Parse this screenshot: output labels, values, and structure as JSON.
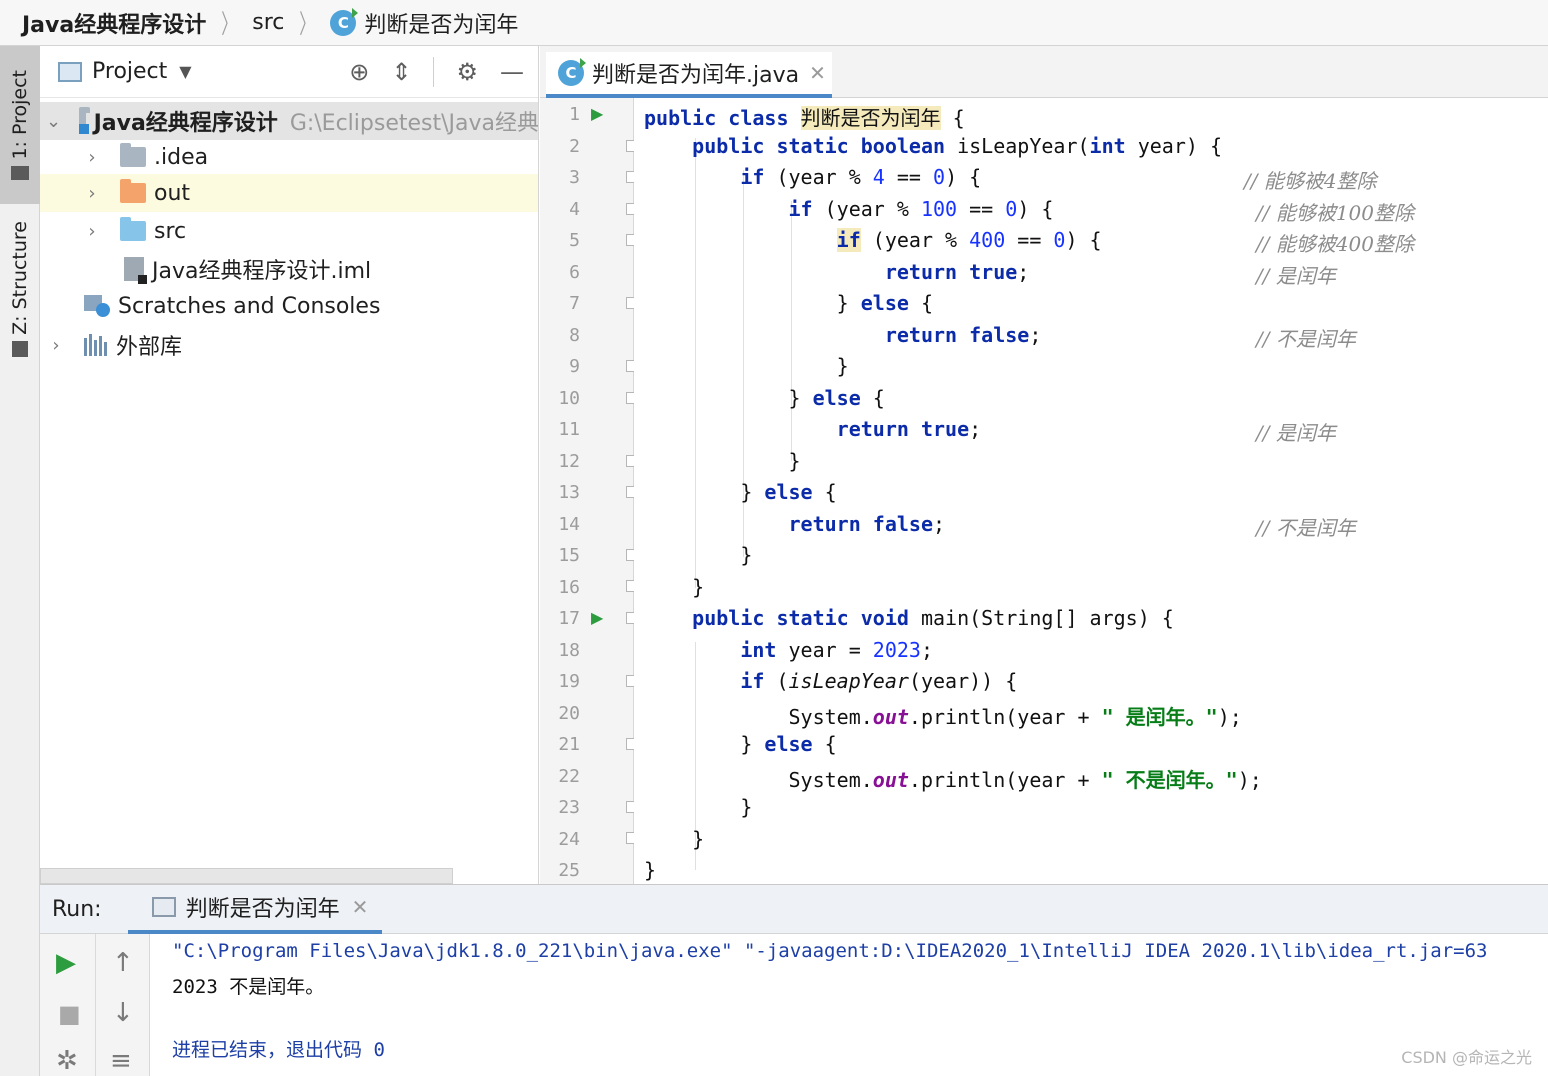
{
  "breadcrumb": {
    "project": "Java经典程序设计",
    "folder": "src",
    "file": "判断是否为闰年"
  },
  "left_strip": {
    "project_tab": "1: Project",
    "structure_tab": "Z: Structure"
  },
  "project_panel": {
    "title": "Project",
    "root_name": "Java经典程序设计",
    "root_path": "G:\\Eclipsetest\\Java经典",
    "items": [
      {
        "label": ".idea",
        "icon": "folder-gray"
      },
      {
        "label": "out",
        "icon": "folder-orange"
      },
      {
        "label": "src",
        "icon": "folder-blue"
      },
      {
        "label": "Java经典程序设计.iml",
        "icon": "iml-file"
      }
    ],
    "scratches": "Scratches and Consoles",
    "external_libs": "外部库"
  },
  "editor": {
    "tab_label": "判断是否为闰年.java",
    "line_numbers": [
      "1",
      "2",
      "3",
      "4",
      "5",
      "6",
      "7",
      "8",
      "9",
      "10",
      "11",
      "12",
      "13",
      "14",
      "15",
      "16",
      "17",
      "18",
      "19",
      "20",
      "21",
      "22",
      "23",
      "24",
      "25"
    ],
    "code": {
      "l1_kw": "public class",
      "l1_name": "判断是否为闰年",
      "l1_tail": " {",
      "l2_kw": "public static boolean",
      "l2_rest": " isLeapYear(",
      "l2_kw2": "int",
      "l2_tail": " year) {",
      "l3_kw": "if",
      "l3_a": " (year % ",
      "l3_n1": "4",
      "l3_b": " == ",
      "l3_n2": "0",
      "l3_c": ") {",
      "l3_cmt": "// 能够被4整除",
      "l4_kw": "if",
      "l4_a": " (year % ",
      "l4_n1": "100",
      "l4_b": " == ",
      "l4_n2": "0",
      "l4_c": ") {",
      "l4_cmt": "// 能够被100整除",
      "l5_kw": "if",
      "l5_a": " (year % ",
      "l5_n1": "400",
      "l5_b": " == ",
      "l5_n2": "0",
      "l5_c": ") {",
      "l5_cmt": "// 能够被400整除",
      "l6_kw": "return true",
      "l6_tail": ";",
      "l6_cmt": "// 是闰年",
      "l7_a": "} ",
      "l7_kw": "else",
      "l7_b": " {",
      "l8_kw": "return false",
      "l8_tail": ";",
      "l8_cmt": "// 不是闰年",
      "l9": "}",
      "l10_a": "} ",
      "l10_kw": "else",
      "l10_b": " {",
      "l11_kw": "return true",
      "l11_tail": ";",
      "l11_cmt": "// 是闰年",
      "l12": "}",
      "l13_a": "} ",
      "l13_kw": "else",
      "l13_b": " {",
      "l14_kw": "return false",
      "l14_tail": ";",
      "l14_cmt": "// 不是闰年",
      "l15": "}",
      "l16": "}",
      "l17_kw": "public static void",
      "l17_rest": " main(String[] args) {",
      "l18_kw": "int",
      "l18_a": " year = ",
      "l18_n": "2023",
      "l18_b": ";",
      "l19_kw": "if",
      "l19_a": " (",
      "l19_method": "isLeapYear",
      "l19_b": "(year)) {",
      "l20_a": "System.",
      "l20_field": "out",
      "l20_b": ".println(year + ",
      "l20_str": "\" 是闰年。\"",
      "l20_c": ");",
      "l21_a": "} ",
      "l21_kw": "else",
      "l21_b": " {",
      "l22_a": "System.",
      "l22_field": "out",
      "l22_b": ".println(year + ",
      "l22_str": "\" 不是闰年。\"",
      "l22_c": ");",
      "l23": "}",
      "l24": "}",
      "l25": "}"
    }
  },
  "run": {
    "label": "Run:",
    "tab_label": "判断是否为闰年",
    "console": {
      "cmd": "\"C:\\Program Files\\Java\\jdk1.8.0_221\\bin\\java.exe\" \"-javaagent:D:\\IDEA2020_1\\IntelliJ IDEA 2020.1\\lib\\idea_rt.jar=63",
      "output": "2023 不是闰年。",
      "exit": "进程已结束，退出代码 0"
    }
  },
  "watermark": "CSDN @命运之光",
  "colors": {
    "keyword": "#0b2ba8",
    "number": "#1733ff",
    "string": "#067d17",
    "comment": "#8c8c8c",
    "tab_underline": "#4a88c7",
    "run_green": "#2d9c3e"
  }
}
